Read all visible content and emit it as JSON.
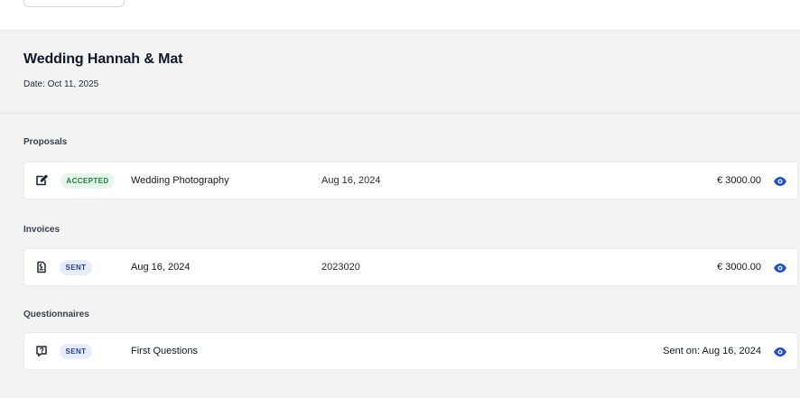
{
  "event": {
    "title": "Wedding Hannah & Mat",
    "date": "Date: Oct 11, 2025"
  },
  "sections": {
    "proposals": {
      "title": "Proposals",
      "items": [
        {
          "icon": "edit-icon",
          "status": "ACCEPTED",
          "name": "Wedding Photography",
          "date": "Aug 16, 2024",
          "amount": "€ 3000.00"
        }
      ]
    },
    "invoices": {
      "title": "Invoices",
      "items": [
        {
          "icon": "invoice-icon",
          "status": "SENT",
          "date": "Aug 16, 2024",
          "number": "2023020",
          "amount": "€ 3000.00"
        }
      ]
    },
    "questionnaires": {
      "title": "Questionnaires",
      "items": [
        {
          "icon": "question-icon",
          "status": "SENT",
          "name": "First Questions",
          "sent": "Sent on: Aug 16, 2024"
        }
      ]
    }
  },
  "colors": {
    "accent": "#1d4ed8",
    "accepted_bg": "#e7f6ea",
    "accepted_text": "#15803d",
    "sent_bg": "#e6ecfb",
    "sent_text": "#1e40af"
  }
}
